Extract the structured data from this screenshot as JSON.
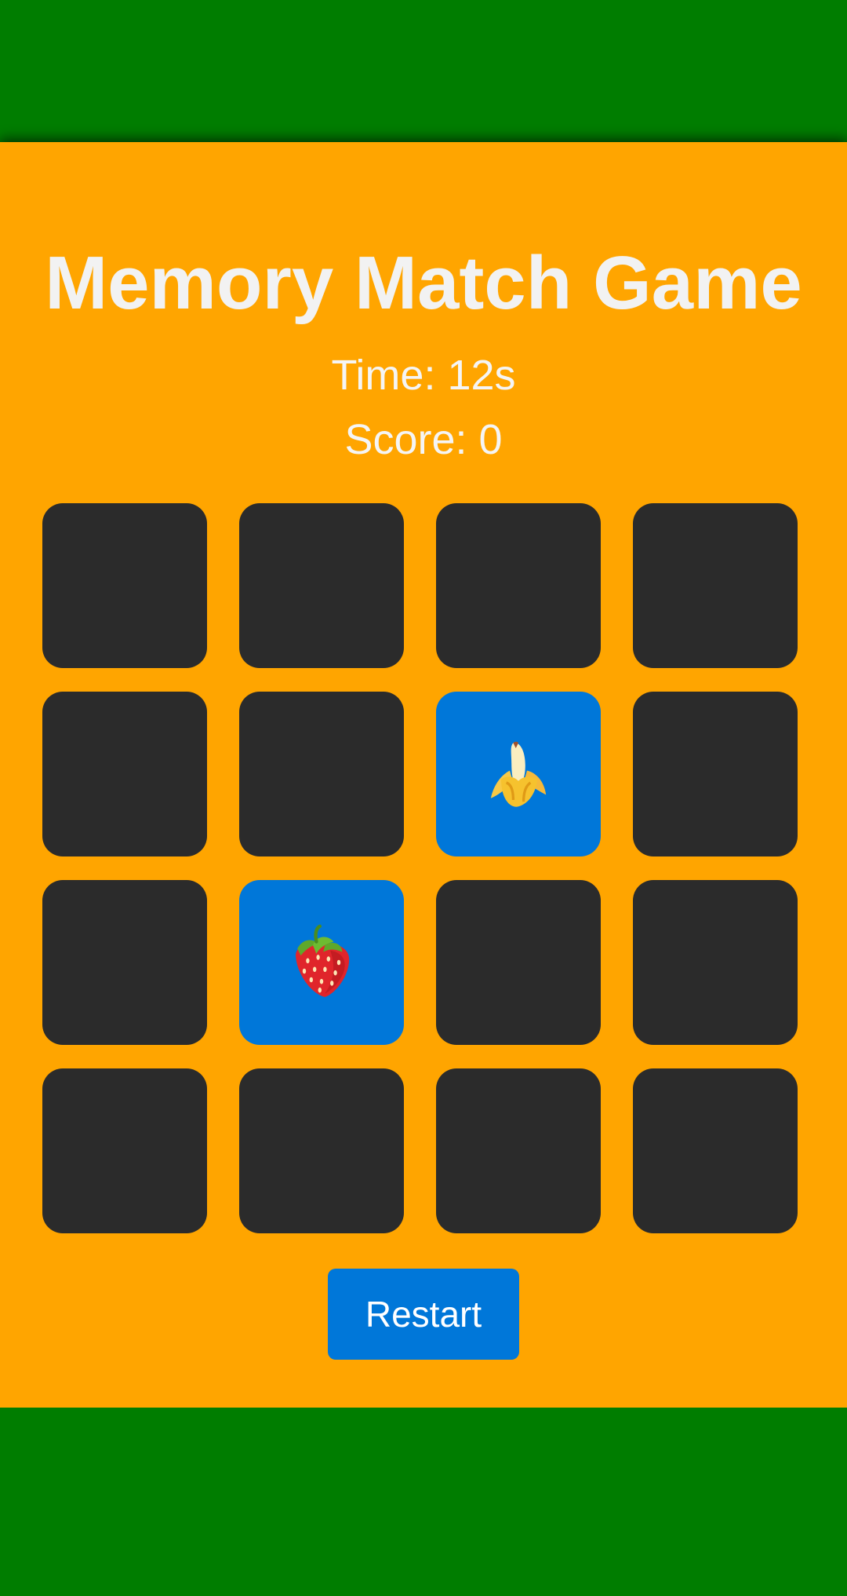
{
  "game": {
    "title": "Memory Match Game",
    "time_label": "Time: 12s",
    "score_label": "Score: 0",
    "restart_label": "Restart"
  },
  "board": {
    "rows": 4,
    "cols": 4,
    "revealed": [
      {
        "row": 2,
        "col": 3,
        "icon": "banana-icon"
      },
      {
        "row": 3,
        "col": 2,
        "icon": "strawberry-icon"
      }
    ]
  },
  "colors": {
    "outer_background": "#007d00",
    "panel_background": "#ffa500",
    "card_back": "#2b2b2b",
    "card_face": "#0077d9",
    "button": "#0077d9",
    "text": "#f2f2f2"
  }
}
